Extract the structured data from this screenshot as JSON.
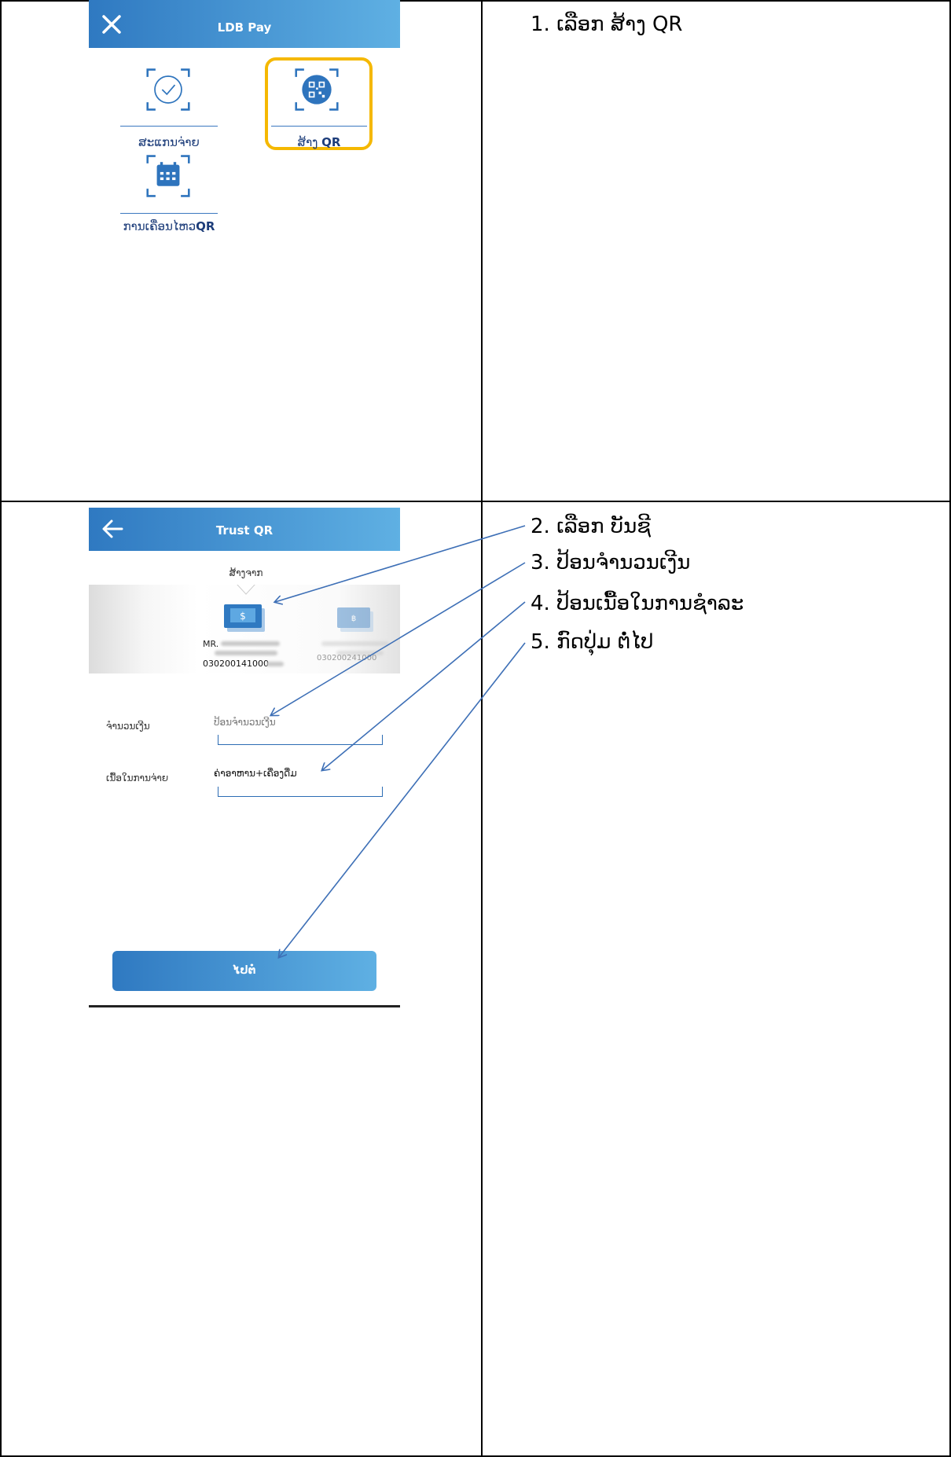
{
  "screen1": {
    "header_title": "LDB Pay",
    "tiles": [
      {
        "label": "ສະແກນຈ່າຍ"
      },
      {
        "label": "ສ້າງ",
        "label_bold": "QR"
      },
      {
        "label": "ການເຄື່ອນໄຫວ",
        "label_bold": "QR"
      }
    ]
  },
  "screen2": {
    "header_title": "Trust QR",
    "from_label": "ສ້າງຈາກ",
    "account_name_prefix": "MR.",
    "account_number": "030200141000",
    "account2_number": "030200241000",
    "amount_label": "ຈຳນວນເງີນ",
    "amount_placeholder": "ປ້ອນຈຳນວນເງີນ",
    "desc_label": "ເນື້ອໃນການຈ່າຍ",
    "desc_value": "ຄ່າອາຫານ+ເຄື່ອງດື່ມ",
    "next_button": "ໄປຕໍ່"
  },
  "instructions": {
    "step1": "1.  ເລືອກ ສ້າງ QR",
    "step2": "2.  ເລືອກ ບັນຊີ",
    "step3": "3.  ປ້ອນຈຳນວນເງີນ",
    "step4": "4.  ປ້ອນເນື້ອໃນການຊຳລະ",
    "step5": "5.  ກົດປຸ່ມ ຕໍ່ໄປ"
  },
  "colors": {
    "header_start": "#2f79c1",
    "header_end": "#5fb0e3",
    "highlight": "#f5b800",
    "arrow": "#3d6fb6"
  }
}
